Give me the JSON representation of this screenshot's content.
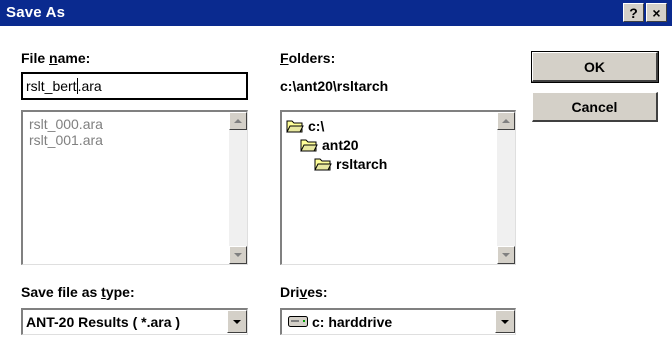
{
  "window": {
    "title": "Save As",
    "help_label": "?",
    "close_label": "×"
  },
  "file_name": {
    "label_pre": "File ",
    "label_key": "n",
    "label_post": "ame:",
    "value_before_caret": "rslt_bert",
    "value_after_caret": ".ara"
  },
  "file_list": {
    "items": [
      "rslt_000.ara",
      "rslt_001.ara"
    ]
  },
  "folders": {
    "label_key": "F",
    "label_post": "olders:",
    "current_path": "c:\\ant20\\rsltarch",
    "tree": [
      {
        "label": "c:\\",
        "icon": "open-folder-icon"
      },
      {
        "label": "ant20",
        "icon": "open-folder-icon"
      },
      {
        "label": "rsltarch",
        "icon": "open-folder-icon"
      }
    ]
  },
  "buttons": {
    "ok": "OK",
    "cancel": "Cancel"
  },
  "save_type": {
    "label_pre": "Save file as ",
    "label_key": "t",
    "label_post": "ype:",
    "value": "ANT-20 Results ( *.ara )"
  },
  "drives": {
    "label_pre": "Dri",
    "label_key": "v",
    "label_post": "es:",
    "value": "c: harddrive",
    "icon": "hard-drive-icon"
  },
  "colors": {
    "titlebar": "#0a2a8f",
    "button_face": "#d4d0c8"
  }
}
